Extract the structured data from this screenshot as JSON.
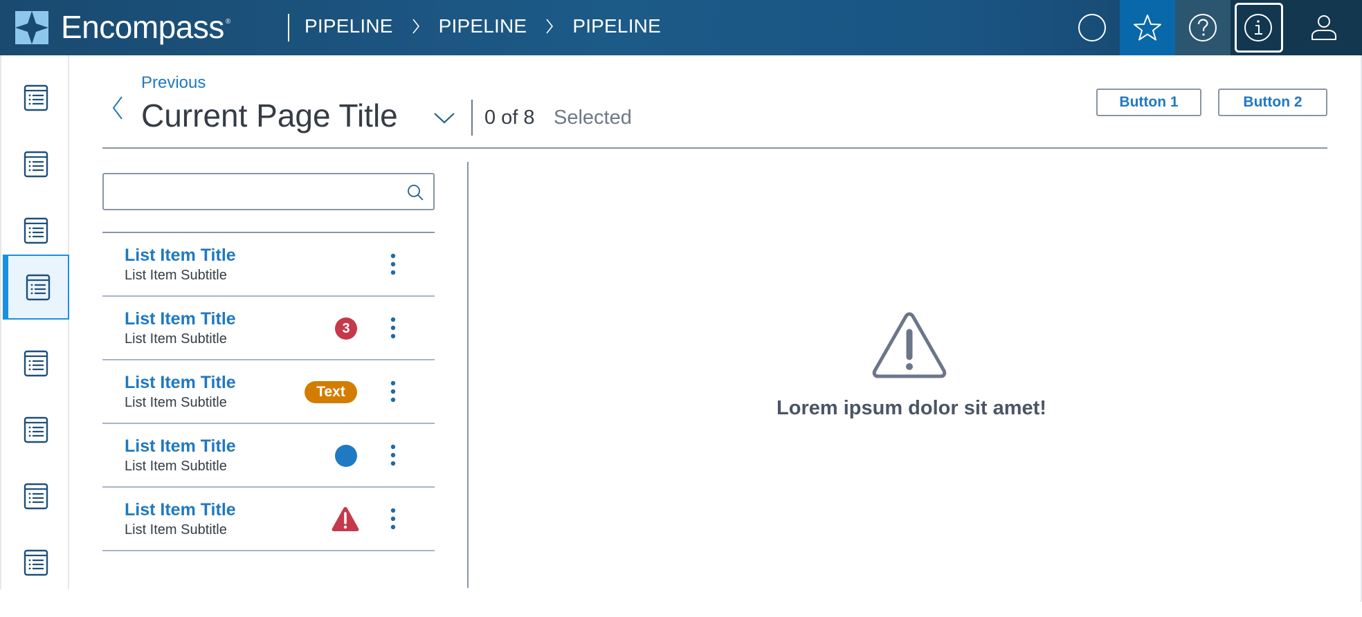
{
  "header": {
    "brand": "Encompass",
    "brand_mark": "®",
    "breadcrumbs": [
      "PIPELINE",
      "PIPELINE",
      "PIPELINE"
    ],
    "actions": [
      {
        "icon": "circle-icon",
        "label": ""
      },
      {
        "icon": "star-icon",
        "label": ""
      },
      {
        "icon": "help-icon",
        "label": ""
      },
      {
        "icon": "info-icon",
        "label": ""
      },
      {
        "icon": "user-icon",
        "label": ""
      }
    ],
    "colors": {
      "star_active": "#0868aa",
      "help_bg": "#2c5670",
      "info_bg": "#12374f"
    }
  },
  "rail": {
    "items": [
      {
        "icon": "list-icon",
        "active": false
      },
      {
        "icon": "list-icon",
        "active": false
      },
      {
        "icon": "list-icon",
        "active": false
      },
      {
        "icon": "list-icon",
        "active": true
      },
      {
        "icon": "list-icon",
        "active": false
      },
      {
        "icon": "list-icon",
        "active": false
      },
      {
        "icon": "list-icon",
        "active": false
      },
      {
        "icon": "list-icon",
        "active": false
      }
    ]
  },
  "page": {
    "previous_label": "Previous",
    "title": "Current Page Title",
    "selection_count": "0 of 8",
    "selection_label": "Selected",
    "buttons": {
      "button1": "Button 1",
      "button2": "Button 2"
    }
  },
  "search": {
    "value": "",
    "placeholder": ""
  },
  "list": {
    "items": [
      {
        "title": "List Item Title",
        "subtitle": "List Item Subtitle",
        "indicator": "none"
      },
      {
        "title": "List Item Title",
        "subtitle": "List Item Subtitle",
        "indicator": "count",
        "badge": "3"
      },
      {
        "title": "List Item Title",
        "subtitle": "List Item Subtitle",
        "indicator": "pill",
        "badge": "Text"
      },
      {
        "title": "List Item Title",
        "subtitle": "List Item Subtitle",
        "indicator": "dot"
      },
      {
        "title": "List Item Title",
        "subtitle": "List Item Subtitle",
        "indicator": "warning"
      }
    ]
  },
  "empty_state": {
    "icon": "warning-icon",
    "message": "Lorem ipsum dolor sit amet!"
  },
  "colors": {
    "link": "#1f78c1",
    "badge_count": "#c5394b",
    "badge_pill": "#d27d00",
    "status_dot": "#2079c3",
    "warning": "#c5394b"
  }
}
